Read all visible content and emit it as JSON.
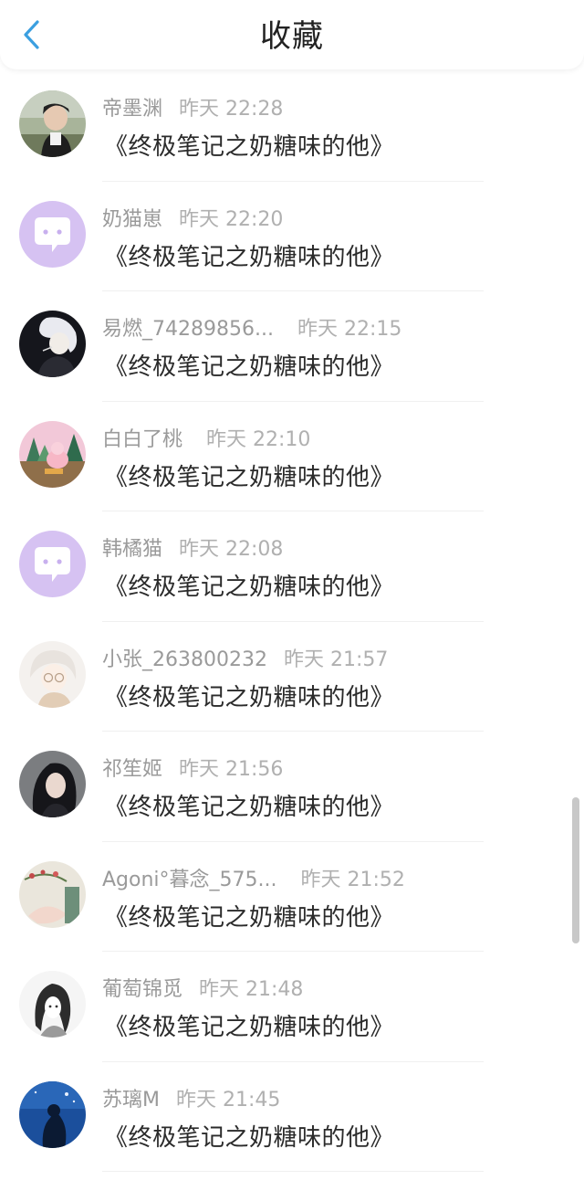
{
  "header": {
    "title": "收藏",
    "back_icon": "chevron-left-icon",
    "accent_color": "#3b9fe0"
  },
  "favorites": [
    {
      "username": "帝墨渊",
      "time": "昨天 22:28",
      "book_title": "《终极笔记之奶糖味的他》",
      "avatar": "photo-boy-icon"
    },
    {
      "username": "奶猫崽",
      "time": "昨天 22:20",
      "book_title": "《终极笔记之奶糖味的他》",
      "avatar": "default-chat-bubble-icon"
    },
    {
      "username": "易燃_74289856...",
      "time": "昨天 22:15",
      "book_title": "《终极笔记之奶糖味的他》",
      "avatar": "anime-white-hair-icon"
    },
    {
      "username": "白白了桃",
      "time": "昨天 22:10",
      "book_title": "《终极笔记之奶糖味的他》",
      "avatar": "illustration-forest-icon"
    },
    {
      "username": "韩橘猫",
      "time": "昨天 22:08",
      "book_title": "《终极笔记之奶糖味的他》",
      "avatar": "default-chat-bubble-icon"
    },
    {
      "username": "小张_263800232",
      "time": "昨天 21:57",
      "book_title": "《终极笔记之奶糖味的他》",
      "avatar": "anime-glasses-girl-icon"
    },
    {
      "username": "祁笙姬",
      "time": "昨天 21:56",
      "book_title": "《终极笔记之奶糖味的他》",
      "avatar": "photo-dark-hair-girl-icon"
    },
    {
      "username": "Agoni°暮念_575...",
      "time": "昨天 21:52",
      "book_title": "《终极笔记之奶糖味的他》",
      "avatar": "illustration-flowers-icon"
    },
    {
      "username": "葡萄锦觅",
      "time": "昨天 21:48",
      "book_title": "《终极笔记之奶糖味的他》",
      "avatar": "sketch-girl-icon"
    },
    {
      "username": "苏璃M",
      "time": "昨天 21:45",
      "book_title": "《终极笔记之奶糖味的他》",
      "avatar": "night-sky-silhouette-icon"
    }
  ]
}
